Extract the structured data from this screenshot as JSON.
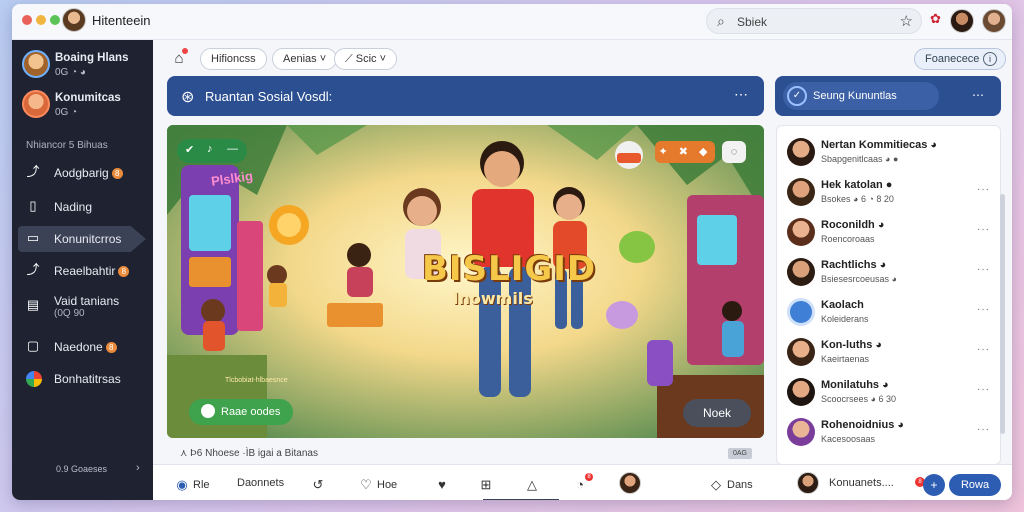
{
  "window": {
    "title": "Hitenteein",
    "traffic_colors": [
      "#e8625a",
      "#f1b640",
      "#5bc357"
    ]
  },
  "search": {
    "label": "Sbiek",
    "icon": "search-icon"
  },
  "sidebar": {
    "contacts": [
      {
        "name": "Boaing Hlans",
        "sub": "0G ◔ ◕"
      },
      {
        "name": "Konumitcas",
        "sub": "0G ◔"
      }
    ],
    "section_label": "Nhiancor 5 Bihuas",
    "items": [
      {
        "label": "Aodgbarig",
        "icon": "share-icon",
        "badge": "8",
        "active": false
      },
      {
        "label": "Nading",
        "icon": "file-icon",
        "active": false
      },
      {
        "label": "Konunitcrros",
        "icon": "window-icon",
        "active": true
      },
      {
        "label": "Reaelbahtir",
        "icon": "share-icon",
        "badge": "8",
        "active": false
      },
      {
        "label": "Vaid tanians",
        "sub": "(0Q 90",
        "icon": "stack-icon",
        "active": false
      },
      {
        "label": "Naedone",
        "icon": "window-icon",
        "badge": "8",
        "active": false
      },
      {
        "label": "Bonhatitrsas",
        "icon": "globe-icon",
        "active": false
      }
    ],
    "footer": "0.9 Goaeses",
    "footer_arrow": "›"
  },
  "toolbar": {
    "chips": [
      "Hifioncss",
      "Aenias ˅",
      "⟋ Scic ˅"
    ],
    "right_chip": "Foanecece",
    "right_chip_icon": "i"
  },
  "main_header": {
    "title": "Ruantan Sosial Vosdl:",
    "more": "⋯"
  },
  "side_header": {
    "title": "Seung Kununtlas",
    "more": "⋯"
  },
  "media": {
    "big_title": "BISLIGID",
    "subtitle": "lnowmils",
    "arcade_sign": "Plslkig",
    "caption": "Tlcbobiat-hlbaesnce",
    "play_label": "Raae oodes",
    "next_label": "Noek",
    "icons_strip": "✦ ✖ ◆",
    "chat_icon": "◌"
  },
  "meta": {
    "text": "Þ6 Nhoese ·ÌB igai a Bitanas",
    "tag": "0AG"
  },
  "bottom_bar": {
    "items": [
      {
        "label": "Rle",
        "icon": "camera-icon"
      },
      {
        "label": "Daonnets",
        "icon": ""
      },
      {
        "label": "",
        "icon": "hand-icon"
      },
      {
        "label": "Hoe",
        "icon": "heart-icon"
      },
      {
        "label": "",
        "icon": "heart-check-icon"
      },
      {
        "label": "",
        "icon": "plus-square-icon"
      },
      {
        "label": "",
        "icon": "triangle-icon"
      },
      {
        "label": "",
        "icon": "bell-icon",
        "badge": "8"
      },
      {
        "label": "Dans",
        "icon": "pin-icon"
      }
    ],
    "compose_label": "Konuanets....",
    "compose_badge": "8",
    "send_label": "Rowa"
  },
  "panel": {
    "rows": [
      {
        "name": "Nertan Kommitiecas ◕",
        "sub": "Sbapgenitlcaas ◕ ●",
        "more": ""
      },
      {
        "name": "Hek katolan ●",
        "sub": "Bsokes ◕ 6 ◔ 8 20",
        "more": "···"
      },
      {
        "name": "Roconildh ◕",
        "sub": "Roencoroaas",
        "more": "···"
      },
      {
        "name": "Rachtlichs ◕",
        "sub": "Bsiesesrcoeusas ◕",
        "more": "···"
      },
      {
        "name": "Kaolach",
        "sub": "Koleiderans",
        "more": "···"
      },
      {
        "name": "Kon-luths ◕",
        "sub": "Kaeirtaenas",
        "more": "···"
      },
      {
        "name": "Monilatuhs ◕",
        "sub": "Scoocrsees ◕ 6 30",
        "more": "···"
      },
      {
        "name": "Rohenoidnius ◕",
        "sub": "Kacesoosaas",
        "more": "···"
      }
    ]
  }
}
